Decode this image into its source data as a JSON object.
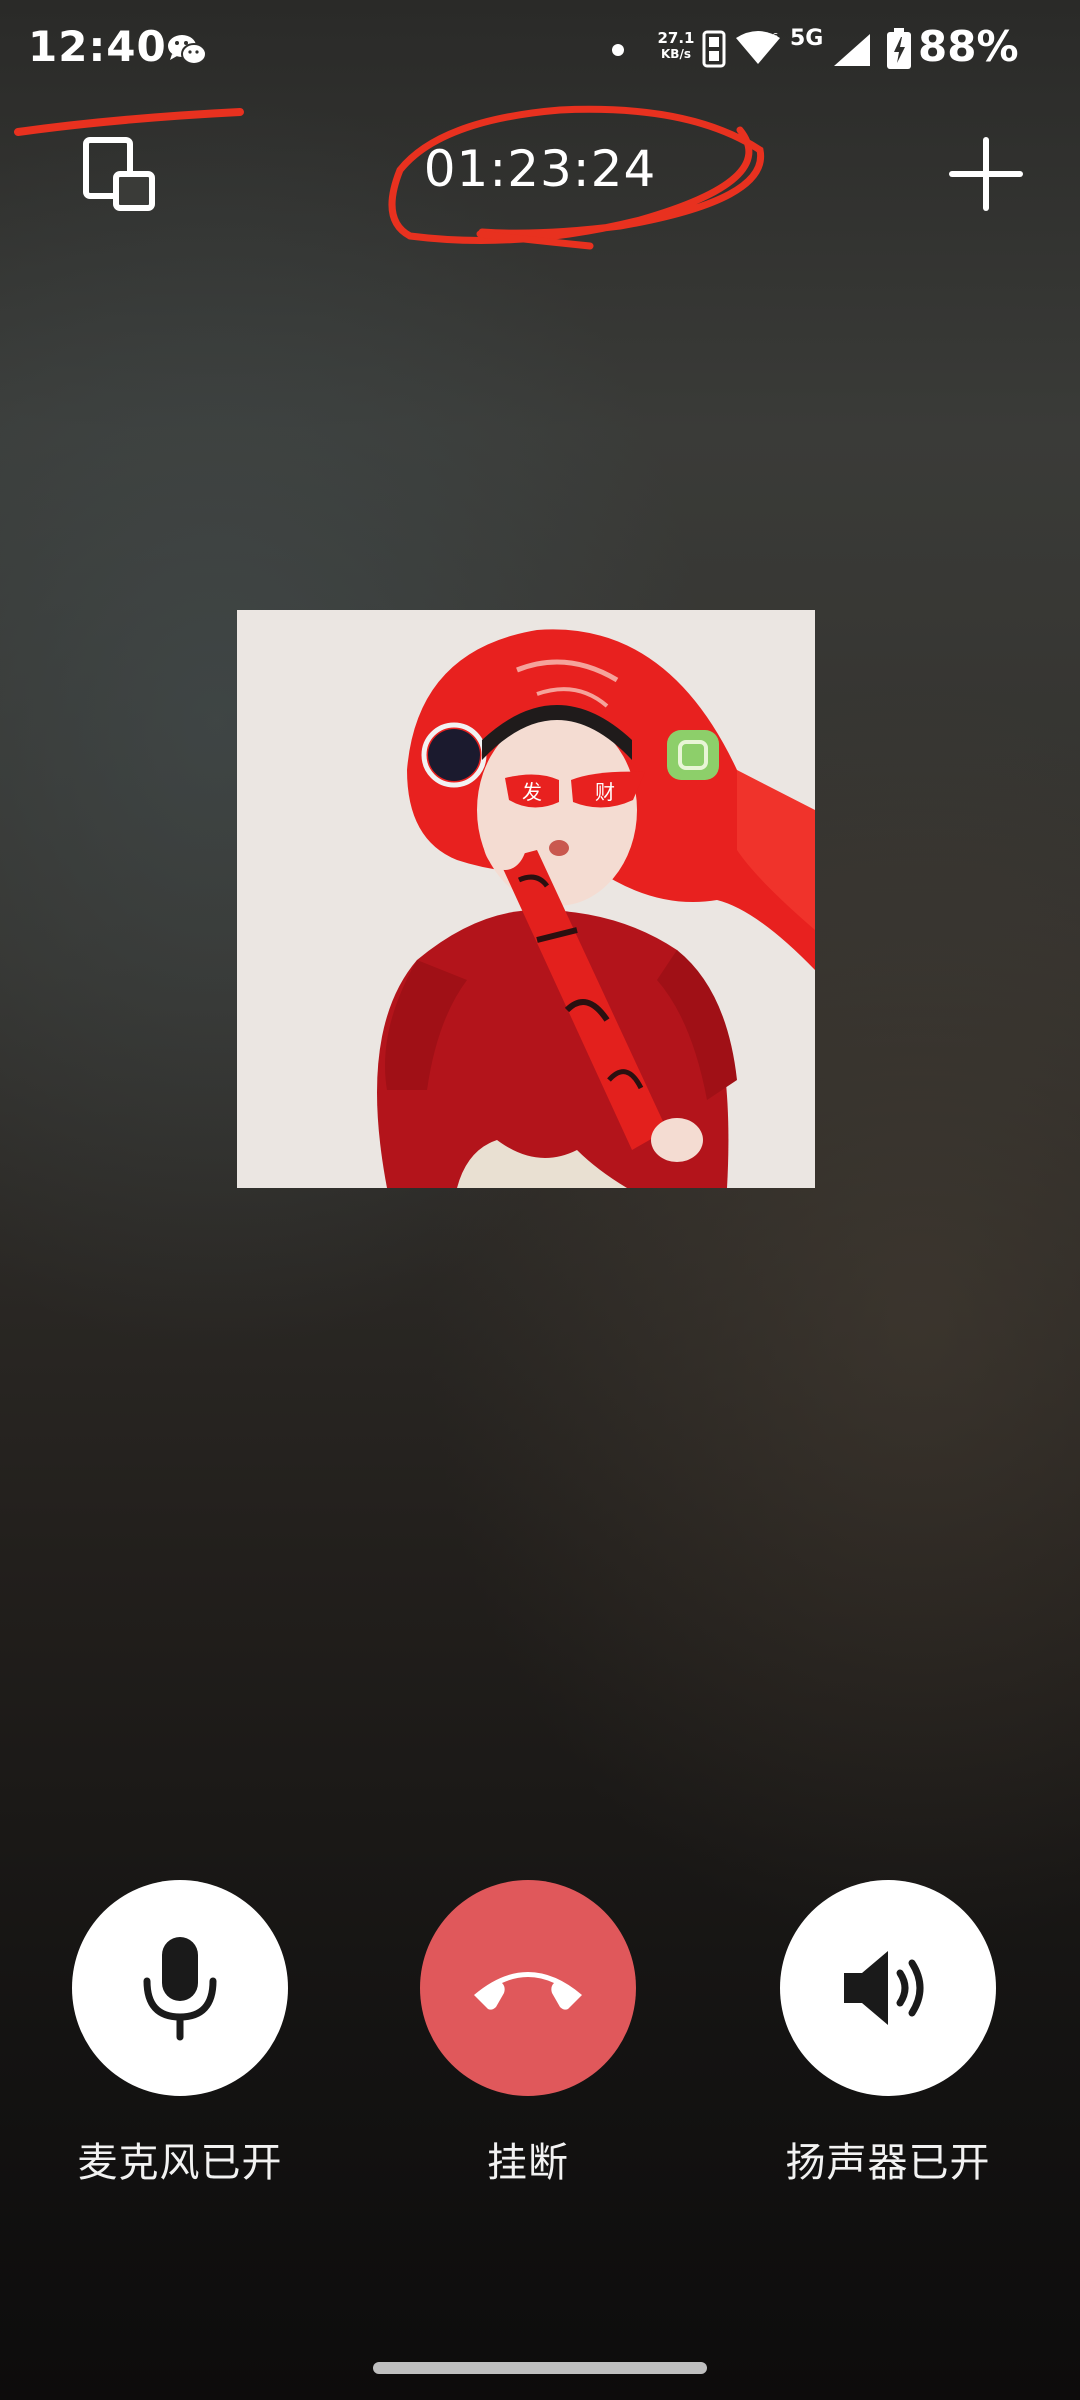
{
  "status_bar": {
    "time": "12:40",
    "net_speed_value": "27.1",
    "net_speed_unit": "KB/s",
    "network": "5G",
    "battery": "88%",
    "icons": [
      "wechat-icon",
      "hd-icon",
      "wifi-icon",
      "signal-icon",
      "battery-icon"
    ]
  },
  "call": {
    "duration": "01:23:24",
    "icons": [
      "minimize-icon",
      "plus-icon"
    ]
  },
  "avatar": {
    "glasses_text_left": "发",
    "glasses_text_right": "财"
  },
  "controls": {
    "mic_label": "麦克风已开",
    "hangup_label": "挂断",
    "speaker_label": "扬声器已开"
  },
  "colors": {
    "hangup": "#e0585b",
    "annotation": "#e8311f"
  }
}
